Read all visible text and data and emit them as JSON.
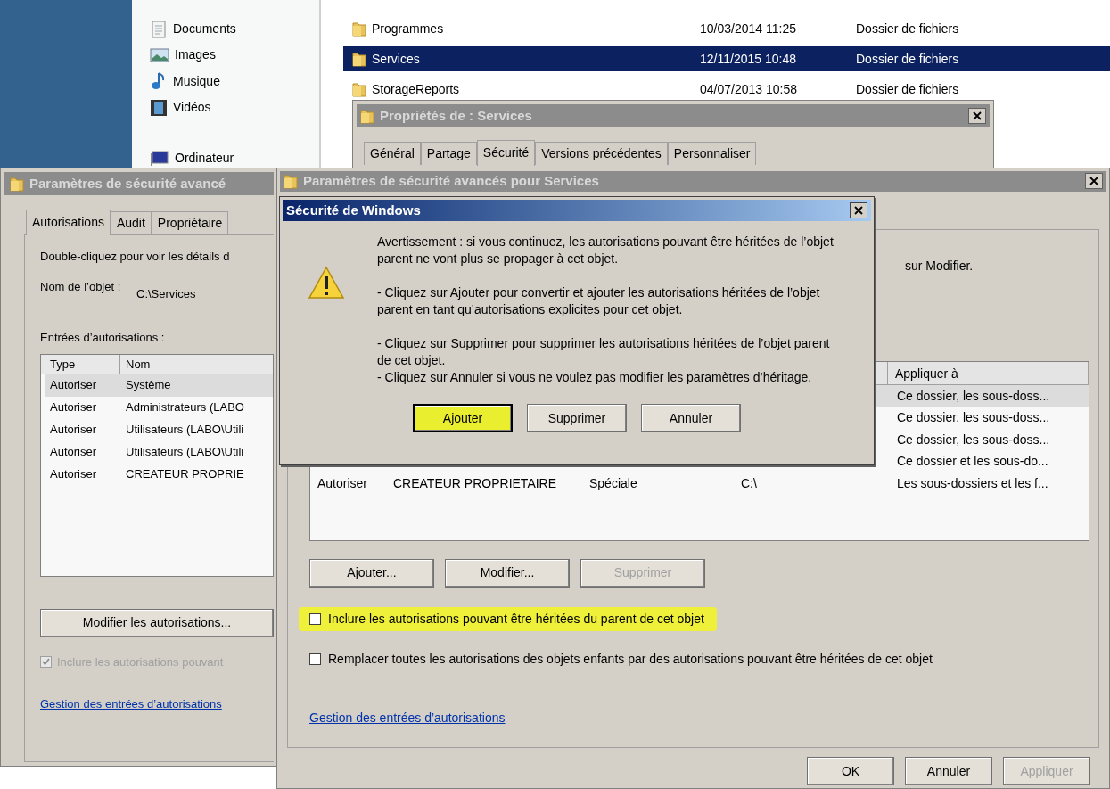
{
  "explorer": {
    "nav_items": [
      {
        "kind": "documents",
        "label": "Documents"
      },
      {
        "kind": "images",
        "label": "Images"
      },
      {
        "kind": "music",
        "label": "Musique"
      },
      {
        "kind": "videos",
        "label": "Vidéos"
      },
      {
        "kind": "computer",
        "label": "Ordinateur"
      }
    ],
    "files": [
      {
        "name": "Programmes",
        "modified": "10/03/2014 11:25",
        "type": "Dossier de fichiers",
        "selected": false
      },
      {
        "name": "Services",
        "modified": "12/11/2015 10:48",
        "type": "Dossier de fichiers",
        "selected": true
      },
      {
        "name": "StorageReports",
        "modified": "04/07/2013 10:58",
        "type": "Dossier de fichiers",
        "selected": false
      }
    ]
  },
  "properties_window": {
    "title": "Propriétés de : Services",
    "tabs": [
      {
        "label": "Général",
        "selected": false
      },
      {
        "label": "Partage",
        "selected": false
      },
      {
        "label": "Sécurité",
        "selected": true
      },
      {
        "label": "Versions précédentes",
        "selected": false
      },
      {
        "label": "Personnaliser",
        "selected": false
      }
    ]
  },
  "left_window": {
    "title": "Paramètres de sécurité avancé",
    "tabs": [
      {
        "label": "Autorisations",
        "selected": true
      },
      {
        "label": "Audit",
        "selected": false
      },
      {
        "label": "Propriétaire",
        "selected": false
      }
    ],
    "instruction": "Double-cliquez pour voir les détails d",
    "object_label": "Nom de l’objet :",
    "object_value": "C:\\Services",
    "entries_label": "Entrées d’autorisations :",
    "columns": [
      "Type",
      "Nom"
    ],
    "rows": [
      {
        "type": "Autoriser",
        "name": "Système",
        "selected": true
      },
      {
        "type": "Autoriser",
        "name": "Administrateurs (LABO",
        "selected": false
      },
      {
        "type": "Autoriser",
        "name": "Utilisateurs (LABO\\Utili",
        "selected": false
      },
      {
        "type": "Autoriser",
        "name": "Utilisateurs (LABO\\Utili",
        "selected": false
      },
      {
        "type": "Autoriser",
        "name": "CREATEUR PROPRIE",
        "selected": false
      }
    ],
    "edit_button": "Modifier les autorisations...",
    "inherit_checkbox": {
      "label": "Inclure les autorisations pouvant",
      "checked": true,
      "disabled": true
    },
    "link": "Gestion des entrées d’autorisations"
  },
  "main_window": {
    "title": "Paramètres de sécurité avancés pour Services",
    "instruction_tail": "sur Modifier.",
    "apply_header": "Appliquer à",
    "rows": [
      {
        "apply_to": "Ce dossier, les sous-doss...",
        "selected": true
      },
      {
        "apply_to": "Ce dossier, les sous-doss...",
        "selected": false
      },
      {
        "apply_to": "Ce dossier, les sous-doss...",
        "selected": false
      },
      {
        "apply_to": "Ce dossier et les sous-do...",
        "selected": false
      },
      {
        "type": "Autoriser",
        "name": "CREATEUR PROPRIETAIRE",
        "permission": "Spéciale",
        "inherited_from": "C:\\",
        "apply_to": "Les sous-dossiers et les f...",
        "selected": false
      }
    ],
    "buttons": [
      {
        "label": "Ajouter...",
        "disabled": false
      },
      {
        "label": "Modifier...",
        "disabled": false
      },
      {
        "label": "Supprimer",
        "disabled": true
      }
    ],
    "checkboxes": [
      {
        "label": "Inclure les autorisations pouvant être héritées du parent de cet objet",
        "checked": false,
        "highlighted": true
      },
      {
        "label": "Remplacer toutes les autorisations des objets enfants par des autorisations pouvant être héritées de cet objet",
        "checked": false,
        "highlighted": false
      }
    ],
    "link": "Gestion des entrées d’autorisations",
    "footer_buttons": [
      {
        "label": "OK",
        "disabled": false
      },
      {
        "label": "Annuler",
        "disabled": false
      },
      {
        "label": "Appliquer",
        "disabled": true
      }
    ]
  },
  "dialog": {
    "title": "Sécurité de Windows",
    "paragraphs": [
      "Avertissement : si vous continuez, les autorisations pouvant être héritées de l’objet parent ne vont plus se propager à cet objet.",
      "- Cliquez sur Ajouter pour convertir et ajouter les autorisations héritées de l’objet parent en tant qu’autorisations explicites pour cet objet.",
      "- Cliquez sur Supprimer pour supprimer les autorisations héritées de l’objet parent de cet objet.",
      "- Cliquez sur Annuler si vous ne voulez pas modifier les paramètres d’héritage."
    ],
    "buttons": [
      {
        "label": "Ajouter",
        "highlighted": true,
        "default": true
      },
      {
        "label": "Supprimer",
        "highlighted": false,
        "default": false
      },
      {
        "label": "Annuler",
        "highlighted": false,
        "default": false
      }
    ]
  }
}
